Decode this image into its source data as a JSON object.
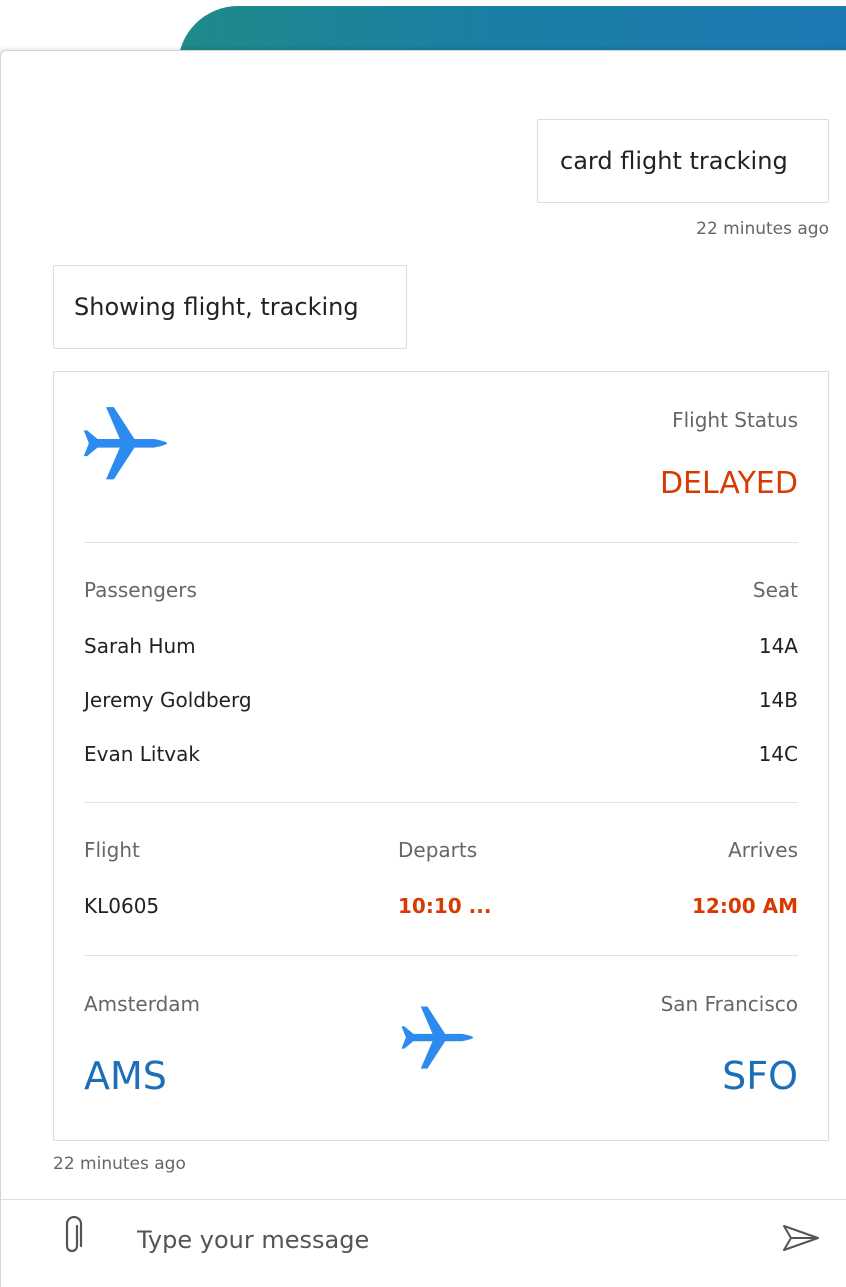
{
  "colors": {
    "accent_blue": "#1c6fb7",
    "plane_blue": "#2d8bf0",
    "status_orange": "#d83b01",
    "banner_teal": "#1f8a8a"
  },
  "messages": {
    "user": {
      "text": "card flight tracking",
      "time": "22 minutes ago"
    },
    "bot": {
      "text": "Showing flight, tracking",
      "time": "22 minutes ago"
    }
  },
  "card": {
    "icon": "airplane-icon",
    "status_label": "Flight Status",
    "status_value": "DELAYED",
    "passengers_header": "Passengers",
    "seat_header": "Seat",
    "passengers": [
      {
        "name": "Sarah Hum",
        "seat": "14A"
      },
      {
        "name": "Jeremy Goldberg",
        "seat": "14B"
      },
      {
        "name": "Evan Litvak",
        "seat": "14C"
      }
    ],
    "flight_header": "Flight",
    "departs_header": "Departs",
    "arrives_header": "Arrives",
    "flight_number": "KL0605",
    "departs_time": "10:10 ...",
    "arrives_time": "12:00 AM",
    "from_city": "Amsterdam",
    "from_code": "AMS",
    "to_city": "San Francisco",
    "to_code": "SFO"
  },
  "composer": {
    "placeholder": "Type your message",
    "attach_icon": "paperclip-icon",
    "send_icon": "send-icon"
  }
}
